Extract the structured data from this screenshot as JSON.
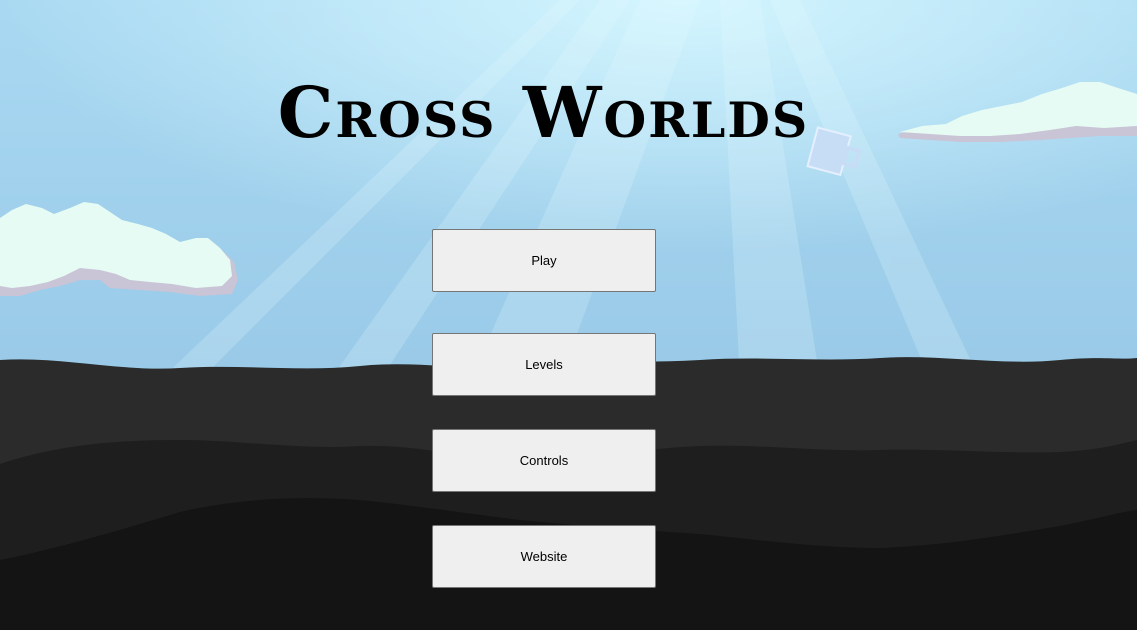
{
  "game": {
    "title": "Cross Worlds"
  },
  "menu": {
    "play_label": "Play",
    "levels_label": "Levels",
    "controls_label": "Controls",
    "website_label": "Website"
  },
  "colors": {
    "sky_top": "#bfeeff",
    "sky_bottom": "#8fc0e2",
    "ground_1": "#2b2b2b",
    "ground_2": "#1e1e1e",
    "ground_3": "#141414",
    "cloud": "#e6fbf3",
    "cloud_shadow": "#c9c4d6",
    "button_bg": "#efefef"
  }
}
